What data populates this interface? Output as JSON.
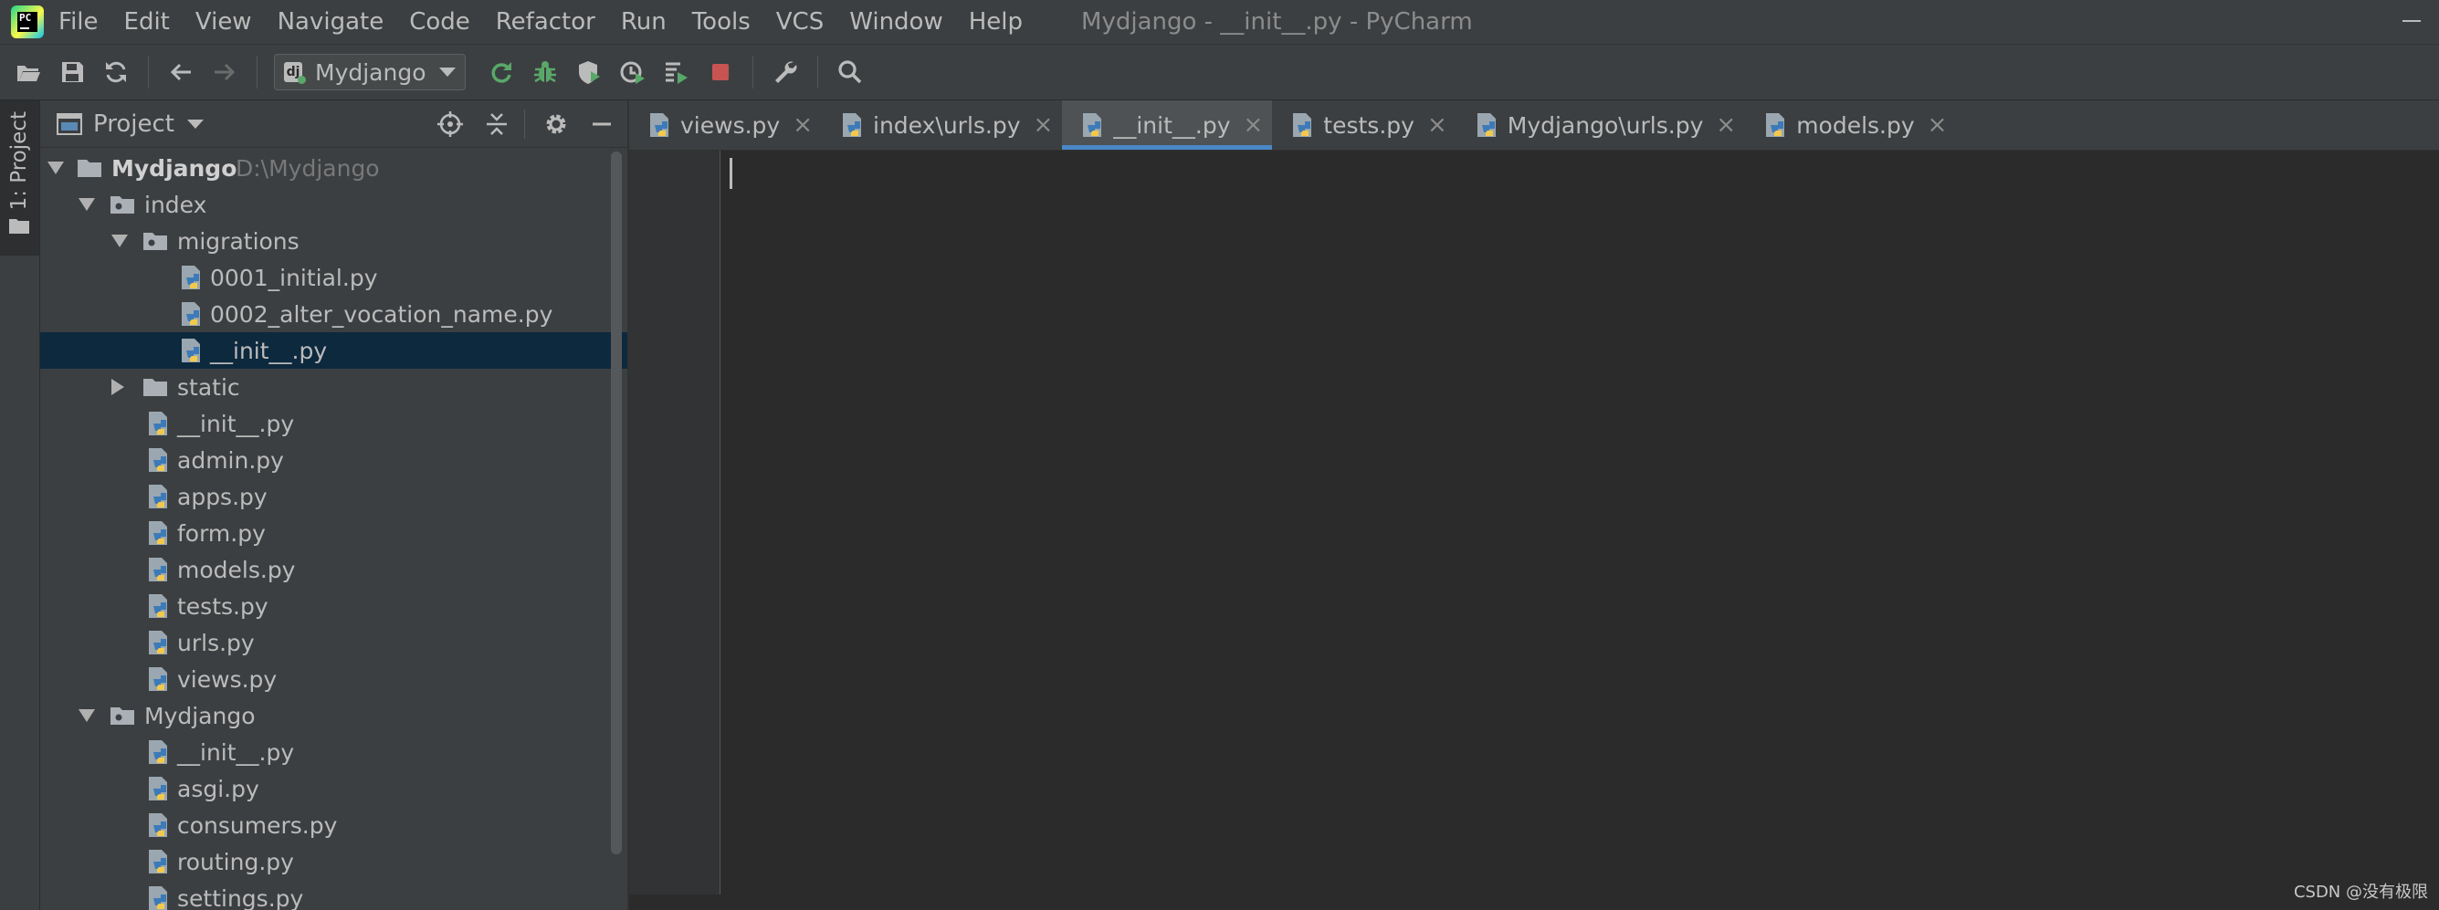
{
  "menu": {
    "items": [
      "File",
      "Edit",
      "View",
      "Navigate",
      "Code",
      "Refactor",
      "Run",
      "Tools",
      "VCS",
      "Window",
      "Help"
    ],
    "window_title": "Mydjango - __init__.py - PyCharm",
    "logo_text": "PC"
  },
  "toolbar": {
    "run_config": "Mydjango",
    "run_config_icon_text": "dj"
  },
  "left_strip": {
    "project_tab": "1: Project"
  },
  "project_panel": {
    "title": "Project",
    "tree": [
      {
        "label": "Mydjango",
        "path": "D:\\Mydjango",
        "kind": "project-folder",
        "expanded": true,
        "bold": true
      },
      {
        "label": "index",
        "kind": "package",
        "expanded": true
      },
      {
        "label": "migrations",
        "kind": "package",
        "expanded": true
      },
      {
        "label": "0001_initial.py",
        "kind": "python-file"
      },
      {
        "label": "0002_alter_vocation_name.py",
        "kind": "python-file"
      },
      {
        "label": "__init__.py",
        "kind": "python-file",
        "selected": true
      },
      {
        "label": "static",
        "kind": "folder",
        "expanded": false
      },
      {
        "label": "__init__.py",
        "kind": "python-file"
      },
      {
        "label": "admin.py",
        "kind": "python-file"
      },
      {
        "label": "apps.py",
        "kind": "python-file"
      },
      {
        "label": "form.py",
        "kind": "python-file"
      },
      {
        "label": "models.py",
        "kind": "python-file"
      },
      {
        "label": "tests.py",
        "kind": "python-file"
      },
      {
        "label": "urls.py",
        "kind": "python-file"
      },
      {
        "label": "views.py",
        "kind": "python-file"
      },
      {
        "label": "Mydjango",
        "kind": "package",
        "expanded": true
      },
      {
        "label": "__init__.py",
        "kind": "python-file"
      },
      {
        "label": "asgi.py",
        "kind": "python-file"
      },
      {
        "label": "consumers.py",
        "kind": "python-file"
      },
      {
        "label": "routing.py",
        "kind": "python-file"
      },
      {
        "label": "settings.py",
        "kind": "python-file"
      }
    ]
  },
  "editor": {
    "tabs": [
      {
        "label": "views.py",
        "active": false
      },
      {
        "label": "index\\urls.py",
        "active": false
      },
      {
        "label": "__init__.py",
        "active": true
      },
      {
        "label": "tests.py",
        "active": false
      },
      {
        "label": "Mydjango\\urls.py",
        "active": false
      },
      {
        "label": "models.py",
        "active": false
      }
    ],
    "close_glyph": "×"
  },
  "watermark": "CSDN @没有极限",
  "colors": {
    "accent": "#4a88c7",
    "selection": "#0d293e",
    "background": "#2b2b2b",
    "panel": "#3c3f41",
    "run_green": "#59a869",
    "stop_red": "#c75450"
  }
}
